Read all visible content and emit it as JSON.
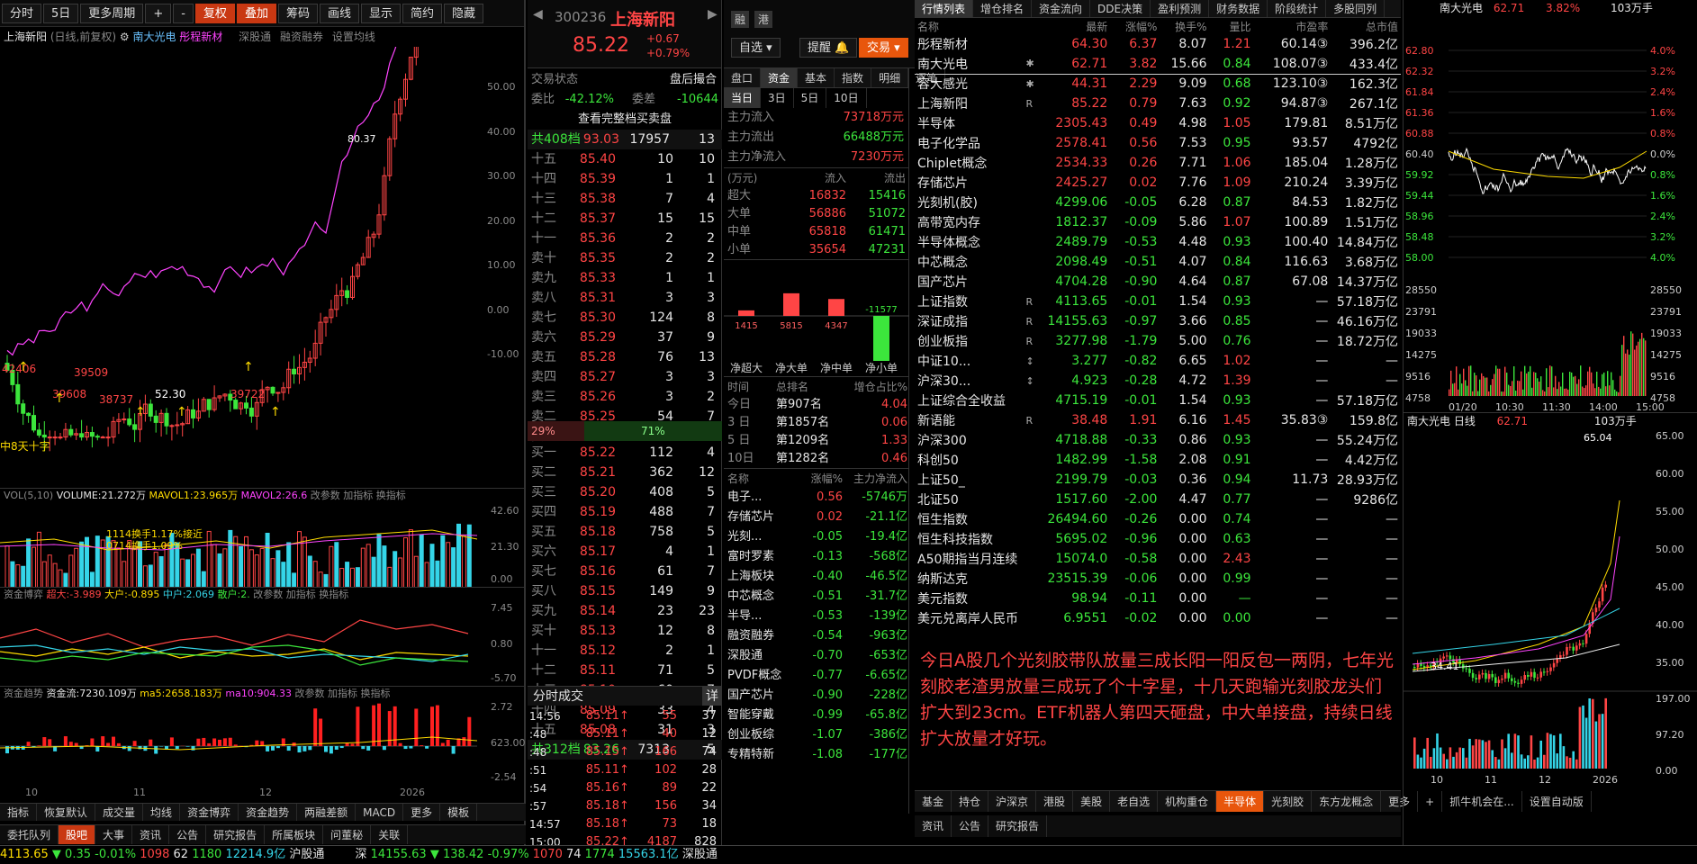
{
  "toolbar": {
    "buttons": [
      "分时",
      "5日",
      "更多周期",
      "+",
      "-",
      "复权",
      "叠加",
      "筹码",
      "画线",
      "显示",
      "简约",
      "隐藏"
    ]
  },
  "kline": {
    "title": "上海新阳",
    "mode": "(日线,前复权)",
    "compare": [
      "南大光电",
      "彤程新材"
    ],
    "links": [
      "深股通",
      "融资融券",
      "设置均线"
    ],
    "yaxis": [
      "50.00",
      "40.00",
      "30.00",
      "20.00",
      "10.00",
      "0.00",
      "-10.00"
    ],
    "price_label": "80.37",
    "low_labels": [
      "42406",
      "39608",
      "39509",
      "38737",
      "52.30",
      "39722"
    ],
    "left_label": "中8天十字"
  },
  "vol": {
    "title": "VOL(5,10)",
    "volume": "VOLUME:21.272万",
    "mavol1": "MAVOL1:23.965万",
    "mavol2": "MAVOL2:26.6",
    "buttons": [
      "改参数",
      "加指标",
      "换指标"
    ],
    "yaxis": [
      "42.60",
      "21.30",
      "0.00"
    ],
    "ann1": "1114换手1.17%接近",
    "ann2": "0714换手1.09%"
  },
  "boyi": {
    "title": "资金博弈",
    "chao": "超大:-3.989",
    "da": "大户:-0.895",
    "zhong": "中户:2.069",
    "san": "散户:2.",
    "buttons": [
      "改参数",
      "加指标",
      "换指标"
    ],
    "yaxis": [
      "7.45",
      "0.80",
      "-5.70"
    ]
  },
  "trend": {
    "title": "资金趋势",
    "flow": "资金流:7230.109万",
    "ma5": "ma5:2658.183万",
    "ma10": "ma10:904.33",
    "buttons": [
      "改参数",
      "加指标",
      "换指标"
    ],
    "yaxis": [
      "2.72",
      "623.00",
      "-2.54"
    ]
  },
  "xaxis": [
    "10",
    "11",
    "12",
    "2026"
  ],
  "bottom_tabs": [
    "指标",
    "恢复默认",
    "成交量",
    "均线",
    "资金博弈",
    "资金趋势",
    "两融差额",
    "MACD",
    "更多",
    "模板"
  ],
  "footer_tabs": [
    "委托队列",
    "股吧",
    "大事",
    "资讯",
    "公告",
    "研究报告",
    "所属板块",
    "问董秘",
    "关联"
  ],
  "status": {
    "sh_index": "4113.65",
    "sh_chg": "0.35",
    "sh_pct": "-0.01%",
    "sh_up": "1098",
    "sh_flat": "62",
    "sh_dn": "1180",
    "sh_amt": "12214.9亿",
    "hgt": "沪股通",
    "sz_label": "深",
    "sz_index": "14155.63",
    "sz_chg": "138.42",
    "sz_pct": "-0.97%",
    "sz_up": "1070",
    "sz_flat": "74",
    "sz_dn": "1774",
    "sz_amt": "15563.1亿",
    "sgt": "深股通"
  },
  "quote": {
    "code": "300236",
    "name": "上海新阳",
    "price": "85.22",
    "chg": "+0.67",
    "pct": "+0.79%",
    "tags": [
      "融",
      "港"
    ],
    "zixuan": "自选",
    "tixing": "提醒",
    "jiaoyi": "交易",
    "state_label": "交易状态",
    "state": "盘后撮合",
    "weibi_label": "委比",
    "weibi": "-42.12%",
    "weicha_label": "委差",
    "weicha": "-10644",
    "full_link": "查看完整档买卖盘",
    "ask_total": {
      "label": "共408档",
      "price": "93.03",
      "vol": "17957",
      "n": "13"
    },
    "asks": [
      {
        "l": "十五",
        "p": "85.40",
        "v": "10",
        "n": "10"
      },
      {
        "l": "十四",
        "p": "85.39",
        "v": "1",
        "n": "1"
      },
      {
        "l": "十三",
        "p": "85.38",
        "v": "7",
        "n": "4"
      },
      {
        "l": "十二",
        "p": "85.37",
        "v": "15",
        "n": "15"
      },
      {
        "l": "十一",
        "p": "85.36",
        "v": "2",
        "n": "2"
      },
      {
        "l": "卖十",
        "p": "85.35",
        "v": "2",
        "n": "2"
      },
      {
        "l": "卖九",
        "p": "85.33",
        "v": "1",
        "n": "1"
      },
      {
        "l": "卖八",
        "p": "85.31",
        "v": "3",
        "n": "3"
      },
      {
        "l": "卖七",
        "p": "85.30",
        "v": "124",
        "n": "8"
      },
      {
        "l": "卖六",
        "p": "85.29",
        "v": "37",
        "n": "9"
      },
      {
        "l": "卖五",
        "p": "85.28",
        "v": "76",
        "n": "13"
      },
      {
        "l": "卖四",
        "p": "85.27",
        "v": "3",
        "n": "3"
      },
      {
        "l": "卖三",
        "p": "85.26",
        "v": "3",
        "n": "2"
      },
      {
        "l": "卖二",
        "p": "85.25",
        "v": "54",
        "n": "7"
      },
      {
        "l": "卖一",
        "p": "85.23",
        "v": "5",
        "n": "3"
      }
    ],
    "ratio_sell": "29%",
    "ratio_buy": "71%",
    "bids": [
      {
        "l": "买一",
        "p": "85.22",
        "v": "112",
        "n": "4"
      },
      {
        "l": "买二",
        "p": "85.21",
        "v": "362",
        "n": "12"
      },
      {
        "l": "买三",
        "p": "85.20",
        "v": "408",
        "n": "5"
      },
      {
        "l": "买四",
        "p": "85.19",
        "v": "488",
        "n": "7"
      },
      {
        "l": "买五",
        "p": "85.18",
        "v": "758",
        "n": "5"
      },
      {
        "l": "买六",
        "p": "85.17",
        "v": "4",
        "n": "1"
      },
      {
        "l": "买七",
        "p": "85.16",
        "v": "61",
        "n": "7"
      },
      {
        "l": "买八",
        "p": "85.15",
        "v": "149",
        "n": "9"
      },
      {
        "l": "买九",
        "p": "85.14",
        "v": "23",
        "n": "23"
      },
      {
        "l": "买十",
        "p": "85.13",
        "v": "12",
        "n": "8"
      },
      {
        "l": "十一",
        "p": "85.12",
        "v": "2",
        "n": "1"
      },
      {
        "l": "十二",
        "p": "85.11",
        "v": "71",
        "n": "5"
      },
      {
        "l": "十三",
        "p": "85.10",
        "v": "60",
        "n": "7"
      },
      {
        "l": "十四",
        "p": "85.09",
        "v": "33",
        "n": "4"
      },
      {
        "l": "十五",
        "p": "85.08",
        "v": "31",
        "n": "3"
      }
    ],
    "bid_total": {
      "label": "共312档",
      "price": "83.26",
      "vol": "7313",
      "n": "5"
    },
    "ticks_title": "分时成交",
    "ticks_btn": "详",
    "ticks": [
      {
        "t": "14:56",
        "p": "85.11",
        "v": "55",
        "n": "37"
      },
      {
        "t": ":48",
        "p": "85.11",
        "v": "40",
        "n": "12"
      },
      {
        "t": ":48",
        "p": "85.15",
        "v": "166",
        "n": "74"
      },
      {
        "t": ":51",
        "p": "85.11",
        "v": "102",
        "n": "28"
      },
      {
        "t": ":54",
        "p": "85.16",
        "v": "89",
        "n": "22"
      },
      {
        "t": ":57",
        "p": "85.18",
        "v": "156",
        "n": "34"
      },
      {
        "t": "14:57",
        "p": "85.18",
        "v": "73",
        "n": "18"
      },
      {
        "t": "15:00",
        "p": "85.22",
        "v": "4187",
        "n": "828"
      }
    ]
  },
  "fund": {
    "tabs": [
      "盘口",
      "资金",
      "基本",
      "指数",
      "明细",
      "逐笔"
    ],
    "periods": [
      "当日",
      "3日",
      "5日",
      "10日"
    ],
    "inflow_label": "主力流入",
    "inflow": "73718万元",
    "outflow_label": "主力流出",
    "outflow": "66488万元",
    "net_label": "主力净流入",
    "net": "7230万元",
    "unit": "(万元)",
    "in_label": "流入",
    "out_label": "流出",
    "rows": [
      {
        "l": "超大",
        "in": "16832",
        "out": "15416"
      },
      {
        "l": "大单",
        "in": "56886",
        "out": "51072"
      },
      {
        "l": "中单",
        "in": "65818",
        "out": "61471"
      },
      {
        "l": "小单",
        "in": "35654",
        "out": "47231"
      }
    ],
    "bars": [
      {
        "label": "净超大",
        "value": 1415
      },
      {
        "label": "净大单",
        "value": 5815
      },
      {
        "label": "净中单",
        "value": 4347
      },
      {
        "label": "净小单",
        "value": -11577
      }
    ],
    "rank_head": [
      "时间",
      "总排名",
      "增仓占比%"
    ],
    "ranks": [
      {
        "t": "今日",
        "r": "第907名",
        "p": "4.04"
      },
      {
        "t": "3 日",
        "r": "第1857名",
        "p": "0.06"
      },
      {
        "t": "5 日",
        "r": "第1209名",
        "p": "1.33"
      },
      {
        "t": "10日",
        "r": "第1282名",
        "p": "0.46"
      }
    ],
    "sect_head": [
      "名称",
      "涨幅%",
      "主力净流入"
    ],
    "sectors": [
      {
        "n": "电子...",
        "c": "0.56",
        "f": "-5746万"
      },
      {
        "n": "存储芯片",
        "c": "0.02",
        "f": "-21.1亿"
      },
      {
        "n": "光刻...",
        "c": "-0.05",
        "f": "-19.4亿"
      },
      {
        "n": "富时罗素",
        "c": "-0.13",
        "f": "-568亿"
      },
      {
        "n": "上海板块",
        "c": "-0.40",
        "f": "-46.5亿"
      },
      {
        "n": "中芯概念",
        "c": "-0.51",
        "f": "-31.7亿"
      },
      {
        "n": "半导...",
        "c": "-0.53",
        "f": "-139亿"
      },
      {
        "n": "融资融券",
        "c": "-0.54",
        "f": "-963亿"
      },
      {
        "n": "深股通",
        "c": "-0.70",
        "f": "-653亿"
      },
      {
        "n": "PVDF概念",
        "c": "-0.77",
        "f": "-6.65亿"
      },
      {
        "n": "国产芯片",
        "c": "-0.90",
        "f": "-228亿"
      },
      {
        "n": "智能穿戴",
        "c": "-0.99",
        "f": "-65.8亿"
      },
      {
        "n": "创业板综",
        "c": "-1.07",
        "f": "-386亿"
      },
      {
        "n": "专精特新",
        "c": "-1.08",
        "f": "-177亿"
      }
    ]
  },
  "watch": {
    "tabs": [
      "行情列表",
      "增仓排名",
      "资金流向",
      "DDE决策",
      "盈利预测",
      "财务数据",
      "阶段统计",
      "多股同列"
    ],
    "cols": [
      "名称",
      "",
      "最新",
      "涨幅%",
      "换手%",
      "量比",
      "市盈率",
      "总市值"
    ],
    "rows": [
      {
        "n": "彤程新材",
        "f": "",
        "p": "64.30",
        "c": "6.37",
        "h": "8.07",
        "q": "1.21",
        "pe": "60.14③",
        "m": "396.2亿",
        "d": 1
      },
      {
        "n": "南大光电",
        "f": "✱",
        "p": "62.71",
        "c": "3.82",
        "h": "15.66",
        "q": "0.84",
        "pe": "108.07③",
        "m": "433.4亿",
        "d": 1
      },
      {
        "n": "容大感光",
        "f": "✱",
        "p": "44.31",
        "c": "2.29",
        "h": "9.09",
        "q": "0.68",
        "pe": "123.10③",
        "m": "162.3亿",
        "d": 1
      },
      {
        "n": "上海新阳",
        "f": "R",
        "p": "85.22",
        "c": "0.79",
        "h": "7.63",
        "q": "0.92",
        "pe": "94.87③",
        "m": "267.1亿",
        "d": 1
      },
      {
        "n": "半导体",
        "f": "",
        "p": "2305.43",
        "c": "0.49",
        "h": "4.98",
        "q": "1.05",
        "pe": "179.81",
        "m": "8.51万亿",
        "d": 1
      },
      {
        "n": "电子化学品",
        "f": "",
        "p": "2578.41",
        "c": "0.56",
        "h": "7.53",
        "q": "0.95",
        "pe": "93.57",
        "m": "4792亿",
        "d": 1
      },
      {
        "n": "Chiplet概念",
        "f": "",
        "p": "2534.33",
        "c": "0.26",
        "h": "7.71",
        "q": "1.06",
        "pe": "185.04",
        "m": "1.28万亿",
        "d": 1
      },
      {
        "n": "存储芯片",
        "f": "",
        "p": "2425.27",
        "c": "0.02",
        "h": "7.76",
        "q": "1.09",
        "pe": "210.24",
        "m": "3.39万亿",
        "d": 1
      },
      {
        "n": "光刻机(胶)",
        "f": "",
        "p": "4299.06",
        "c": "-0.05",
        "h": "6.28",
        "q": "0.87",
        "pe": "84.53",
        "m": "1.82万亿",
        "d": 0
      },
      {
        "n": "高带宽内存",
        "f": "",
        "p": "1812.37",
        "c": "-0.09",
        "h": "5.86",
        "q": "1.07",
        "pe": "100.89",
        "m": "1.51万亿",
        "d": 0
      },
      {
        "n": "半导体概念",
        "f": "",
        "p": "2489.79",
        "c": "-0.53",
        "h": "4.48",
        "q": "0.93",
        "pe": "100.40",
        "m": "14.84万亿",
        "d": 0
      },
      {
        "n": "中芯概念",
        "f": "",
        "p": "2098.49",
        "c": "-0.51",
        "h": "4.07",
        "q": "0.84",
        "pe": "116.63",
        "m": "3.68万亿",
        "d": 0
      },
      {
        "n": "国产芯片",
        "f": "",
        "p": "4704.28",
        "c": "-0.90",
        "h": "4.64",
        "q": "0.87",
        "pe": "67.08",
        "m": "14.37万亿",
        "d": 0
      },
      {
        "n": "上证指数",
        "f": "R",
        "p": "4113.65",
        "c": "-0.01",
        "h": "1.54",
        "q": "0.93",
        "pe": "—",
        "m": "57.18万亿",
        "d": 0
      },
      {
        "n": "深证成指",
        "f": "R",
        "p": "14155.63",
        "c": "-0.97",
        "h": "3.66",
        "q": "0.85",
        "pe": "—",
        "m": "46.16万亿",
        "d": 0
      },
      {
        "n": "创业板指",
        "f": "R",
        "p": "3277.98",
        "c": "-1.79",
        "h": "5.00",
        "q": "0.76",
        "pe": "—",
        "m": "18.72万亿",
        "d": 0
      },
      {
        "n": "中证10...",
        "f": "↕",
        "p": "3.277",
        "c": "-0.82",
        "h": "6.65",
        "q": "1.02",
        "pe": "—",
        "m": "—",
        "d": 0
      },
      {
        "n": "沪深30...",
        "f": "↕",
        "p": "4.923",
        "c": "-0.28",
        "h": "4.72",
        "q": "1.39",
        "pe": "—",
        "m": "—",
        "d": 0
      },
      {
        "n": "上证综合全收益",
        "f": "",
        "p": "4715.19",
        "c": "-0.01",
        "h": "1.54",
        "q": "0.93",
        "pe": "—",
        "m": "57.18万亿",
        "d": 0
      },
      {
        "n": "新语能",
        "f": "R",
        "p": "38.48",
        "c": "1.91",
        "h": "6.16",
        "q": "1.45",
        "pe": "35.83③",
        "m": "159.8亿",
        "d": 1
      },
      {
        "n": "沪深300",
        "f": "",
        "p": "4718.88",
        "c": "-0.33",
        "h": "0.86",
        "q": "0.93",
        "pe": "—",
        "m": "55.24万亿",
        "d": 0
      },
      {
        "n": "科创50",
        "f": "",
        "p": "1482.99",
        "c": "-1.58",
        "h": "2.08",
        "q": "0.91",
        "pe": "—",
        "m": "4.42万亿",
        "d": 0
      },
      {
        "n": "上证50_",
        "f": "",
        "p": "2199.79",
        "c": "-0.03",
        "h": "0.36",
        "q": "0.94",
        "pe": "11.73",
        "m": "28.93万亿",
        "d": 0
      },
      {
        "n": "北证50",
        "f": "",
        "p": "1517.60",
        "c": "-2.00",
        "h": "4.47",
        "q": "0.77",
        "pe": "—",
        "m": "9286亿",
        "d": 0
      },
      {
        "n": "恒生指数",
        "f": "",
        "p": "26494.60",
        "c": "-0.26",
        "h": "0.00",
        "q": "0.74",
        "pe": "—",
        "m": "—",
        "d": 0
      },
      {
        "n": "恒生科技指数",
        "f": "",
        "p": "5695.02",
        "c": "-0.96",
        "h": "0.00",
        "q": "0.63",
        "pe": "—",
        "m": "—",
        "d": 0
      },
      {
        "n": "A50期指当月连续",
        "f": "",
        "p": "15074.0",
        "c": "-0.58",
        "h": "0.00",
        "q": "2.43",
        "pe": "—",
        "m": "—",
        "d": 0
      },
      {
        "n": "纳斯达克",
        "f": "",
        "p": "23515.39",
        "c": "-0.06",
        "h": "0.00",
        "q": "0.99",
        "pe": "—",
        "m": "—",
        "d": 0
      },
      {
        "n": "美元指数",
        "f": "",
        "p": "98.94",
        "c": "-0.11",
        "h": "0.00",
        "q": "—",
        "pe": "—",
        "m": "—",
        "d": 0
      },
      {
        "n": "美元兑离岸人民币",
        "f": "",
        "p": "6.9551",
        "c": "-0.02",
        "h": "0.00",
        "q": "0.00",
        "pe": "—",
        "m": "—",
        "d": 0
      }
    ],
    "note": "今日A股几个光刻胶带队放量三成长阳一阳反包一两阴，七年光刻胶老渣男放量三成玩了个十字星，十几天跑输光刻胶龙头们扩大到23cm。ETF机器人第四天砸盘，中大单接盘，持续日线扩大放量才好玩。",
    "bottom_tabs": [
      "基金",
      "持仓",
      "沪深京",
      "港股",
      "美股",
      "老自选",
      "机构重仓",
      "半导体",
      "光刻胶",
      "东方龙概念",
      "更多",
      "+",
      "抓牛机会在...",
      "设置自动版"
    ],
    "sub_tabs": [
      "资讯",
      "公告",
      "研究报告"
    ]
  },
  "mini": {
    "name": "南大光电",
    "price": "62.71",
    "pct": "3.82%",
    "vol": "103万手",
    "prices": [
      "62.80",
      "62.32",
      "61.84",
      "61.36",
      "60.88",
      "60.40",
      "59.92",
      "59.44",
      "58.96",
      "58.48",
      "58.00"
    ],
    "pcts": [
      "4.0%",
      "3.2%",
      "2.4%",
      "1.6%",
      "0.8%",
      "0.0%",
      "0.8%",
      "1.6%",
      "2.4%",
      "3.2%",
      "4.0%"
    ],
    "vols": [
      "28550",
      "23791",
      "19033",
      "14275",
      "9516",
      "4758"
    ],
    "times": [
      "01/20",
      "10:30",
      "11:30",
      "14:00",
      "15:00"
    ],
    "day_title": "南大光电 日线",
    "day_price": "62.71",
    "day_vol": "103万手",
    "day_hi": "65.04",
    "day_lo": "34.41",
    "day_yaxis": [
      "65.00",
      "60.00",
      "55.00",
      "50.00",
      "45.00",
      "40.00",
      "35.00"
    ],
    "day_vaxis": [
      "197.00",
      "97.20",
      "0.00"
    ],
    "day_x": [
      "10",
      "11",
      "12",
      "2026"
    ]
  }
}
